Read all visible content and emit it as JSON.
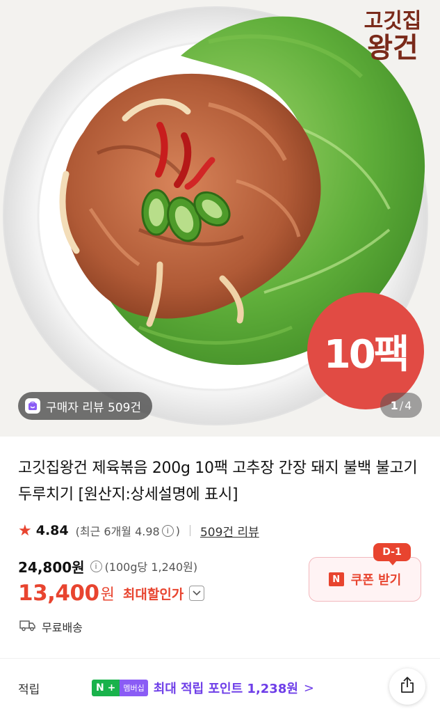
{
  "hero": {
    "brand_logo_line1": "고깃집",
    "brand_logo_line2": "왕건",
    "pack_badge": "10팩",
    "review_chip_text": "구매자 리뷰 509건",
    "page_current": "1",
    "page_total": "4",
    "page_separator": "/"
  },
  "product": {
    "title": "고깃집왕건 제육볶음 200g 10팩 고추장 간장 돼지 불백 불고기 두루치기 [원산지:상세설명에 표시]",
    "rating_star_icon": "star-icon",
    "rating_score": "4.84",
    "rating_recent_text": "(최근 6개월 4.98",
    "rating_recent_close": ")",
    "review_link": "509건 리뷰"
  },
  "price": {
    "original_price": "24,800원",
    "unit_price": "(100g당 1,240원)",
    "sale_price": "13,400",
    "sale_unit": "원",
    "max_discount_label": "최대할인가",
    "coupon_label": "쿠폰 받기",
    "coupon_brand_letter": "N",
    "dday_badge": "D-1"
  },
  "shipping": {
    "label": "무료배송"
  },
  "points": {
    "label": "적립",
    "nplus_badge": "N +",
    "membership_badge": "멤버십",
    "max_points_text": "최대 적립 포인트 1,238원",
    "arrow": ">"
  },
  "colors": {
    "accent_red": "#e8442f",
    "badge_red": "#e14b44",
    "points_purple": "#6e3ee8",
    "naver_green": "#19b24b"
  }
}
